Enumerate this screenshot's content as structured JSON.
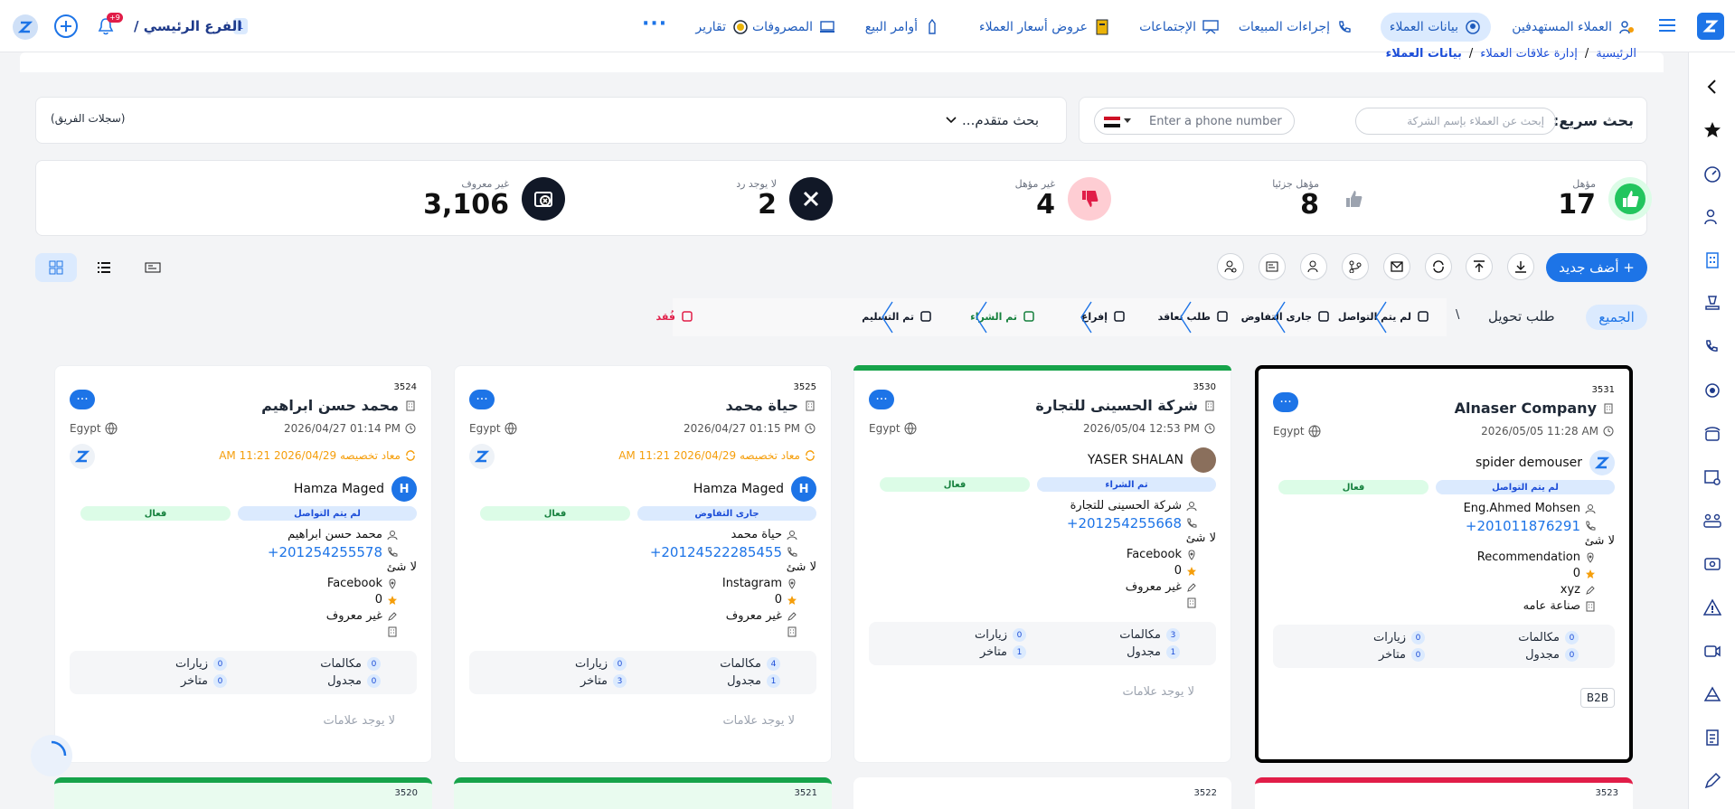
{
  "nav": {
    "items": [
      {
        "label": "العملاء المستهدفين",
        "icon": "target-users-icon"
      },
      {
        "label": "بيانات العملاء",
        "icon": "customer-data-icon",
        "active": true
      },
      {
        "label": "إجراءات المبيعات",
        "icon": "phone-icon"
      },
      {
        "label": "الإجتماعات",
        "icon": "meeting-icon"
      },
      {
        "label": "عروض أسعار العملاء",
        "icon": "quote-icon"
      },
      {
        "label": "أوامر البيع",
        "icon": "sales-order-icon"
      },
      {
        "label": "المصروفات",
        "icon": "expenses-icon"
      },
      {
        "label": "تقارير",
        "icon": "reports-icon"
      }
    ],
    "more": "···",
    "branch_label": "الفرع الرئيسي /",
    "branch_count": "1",
    "notif_count": "+9"
  },
  "breadcrumb": {
    "home": "الرئيسية",
    "sep": "/",
    "section": "إدارة علاقات العملاء",
    "current": "بيانات العملاء"
  },
  "search": {
    "quick_label": "بحث سريع:",
    "company_placeholder": "إبحث عن العملاء بإسم الشركة",
    "phone_placeholder": "Enter a phone number",
    "advanced_label": "بحث متقدم...",
    "team_records": "(سجلات الفريق)"
  },
  "summary": [
    {
      "label": "مؤهل",
      "value": "17",
      "color": "#22c55e",
      "icon": "thumbs-up-icon"
    },
    {
      "label": "مؤهل جزئيا",
      "value": "8",
      "color": "#9ca3af",
      "icon": "thumbs-up-gray-icon"
    },
    {
      "label": "غير مؤهل",
      "value": "4",
      "color": "#e11d48",
      "icon": "thumbs-down-icon"
    },
    {
      "label": "لا يوجد رد",
      "value": "2",
      "color": "#111827",
      "icon": "x-icon"
    },
    {
      "label": "غير معروف",
      "value": "3,106",
      "color": "#111827",
      "icon": "unknown-icon"
    }
  ],
  "toolbar": {
    "add_new": "+ أضف جديد"
  },
  "stages": {
    "all": "الجميع",
    "conversion": "طلب تحويل",
    "sep": "\\",
    "items": [
      {
        "label": "لم يتم التواصل",
        "color": "#111827"
      },
      {
        "label": "جارى التفاوض",
        "color": "#111827"
      },
      {
        "label": "طلب تعاقد",
        "color": "#111827"
      },
      {
        "label": "إفراغ",
        "color": "#111827"
      },
      {
        "label": "تم الشراء",
        "color": "#15803d"
      },
      {
        "label": "تم التسليم",
        "color": "#111827"
      },
      {
        "label": "فُقد",
        "color": "#e11d48"
      }
    ]
  },
  "cards": [
    {
      "id": "3531",
      "title": "Alnaser Company",
      "date": "2026/05/05 11:28 AM",
      "country": "Egypt",
      "owner": "spider demouser",
      "stage": "لم يتم التواصل",
      "status": "فعال",
      "contact": "Eng.Ahmed Mohsen",
      "phone": "+201011876291",
      "note": "لا شئ",
      "source": "Recommendation",
      "rating": "0",
      "tag": "xyz",
      "industry": "صناعة عامه",
      "calls": "0",
      "visits": "0",
      "scheduled": "0",
      "late": "0",
      "calls_label": "مكالمات",
      "visits_label": "زيارات",
      "scheduled_label": "مجدول",
      "late_label": "متاخر",
      "chip": "B2B",
      "topbar": ""
    },
    {
      "id": "3530",
      "title": "شركة الحسينى للتجارة",
      "date": "2026/05/04 12:53 PM",
      "country": "Egypt",
      "owner": "YASER SHALAN",
      "stage": "تم الشراء",
      "status": "فعال",
      "contact": "شركة الحسينى للتجارة",
      "phone": "+201254255668",
      "note": "لا شئ",
      "source": "Facebook",
      "rating": "0",
      "tag": "غير معروف",
      "industry": "",
      "calls": "3",
      "visits": "0",
      "scheduled": "1",
      "late": "1",
      "calls_label": "مكالمات",
      "visits_label": "زيارات",
      "scheduled_label": "مجدول",
      "late_label": "متاخر",
      "nolabels": "لا يوجد علامات",
      "topbar": "#16a34a"
    },
    {
      "id": "3525",
      "title": "حياة محمد",
      "date": "2026/04/27 01:15 PM",
      "country": "Egypt",
      "assigned": "معاد تخصيصه 2026/04/29 11:21 AM",
      "owner": "Hamza Maged",
      "stage": "جارى التفاوض",
      "status": "فعال",
      "contact": "حياة محمد",
      "phone": "+20124522285455",
      "note": "لا شئ",
      "source": "Instagram",
      "rating": "0",
      "tag": "غير معروف",
      "industry": "",
      "calls": "4",
      "visits": "0",
      "scheduled": "1",
      "late": "3",
      "calls_label": "مكالمات",
      "visits_label": "زيارات",
      "scheduled_label": "مجدول",
      "late_label": "متاخر",
      "nolabels": "لا يوجد علامات",
      "topbar": ""
    },
    {
      "id": "3524",
      "title": "محمد حسن ابراهيم",
      "date": "2026/04/27 01:14 PM",
      "country": "Egypt",
      "assigned": "معاد تخصيصه 2026/04/29 11:21 AM",
      "owner": "Hamza Maged",
      "stage": "لم يتم التواصل",
      "status": "فعال",
      "contact": "محمد حسن ابراهيم",
      "phone": "+201254255578",
      "note": "لا شئ",
      "source": "Facebook",
      "rating": "0",
      "tag": "غير معروف",
      "industry": "",
      "calls": "0",
      "visits": "0",
      "scheduled": "0",
      "late": "0",
      "calls_label": "مكالمات",
      "visits_label": "زيارات",
      "scheduled_label": "مجدول",
      "late_label": "متاخر",
      "nolabels": "لا يوجد علامات",
      "topbar": ""
    }
  ],
  "next_cards": [
    "3523",
    "3522",
    "3521",
    "3520"
  ],
  "colors": {
    "primary": "#1d74e7",
    "accent_green": "#16a34a",
    "accent_red": "#e11d48"
  }
}
